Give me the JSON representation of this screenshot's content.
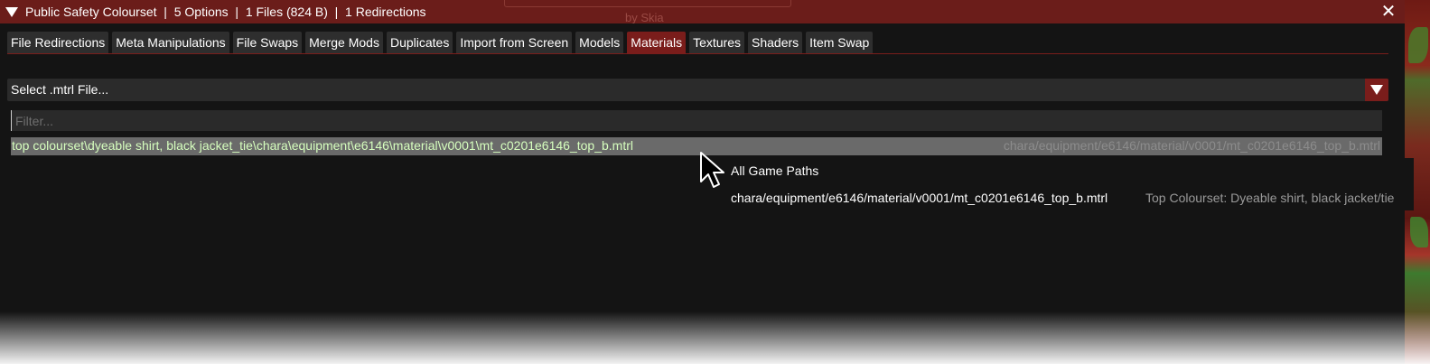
{
  "window": {
    "title": "Public Safety Colourset  |  5 Options  |  1 Files (824 B)  |  1 Redirections",
    "background_title": "by Skia"
  },
  "tabs": [
    {
      "label": "File Redirections"
    },
    {
      "label": "Meta Manipulations"
    },
    {
      "label": "File Swaps"
    },
    {
      "label": "Merge Mods"
    },
    {
      "label": "Duplicates"
    },
    {
      "label": "Import from Screen"
    },
    {
      "label": "Models"
    },
    {
      "label": "Materials",
      "active": true
    },
    {
      "label": "Textures"
    },
    {
      "label": "Shaders"
    },
    {
      "label": "Item Swap"
    }
  ],
  "combo": {
    "label": "Select .mtrl File..."
  },
  "filter": {
    "placeholder": "Filter...",
    "value": ""
  },
  "list": {
    "items": [
      {
        "primary": "top colourset\\dyeable shirt, black jacket_tie\\chara\\equipment\\e6146\\material\\v0001\\mt_c0201e6146_top_b.mtrl",
        "secondary": "chara/equipment/e6146/material/v0001/mt_c0201e6146_top_b.mtrl"
      }
    ]
  },
  "tooltip": {
    "heading": "All Game Paths",
    "path": "chara/equipment/e6146/material/v0001/mt_c0201e6146_top_b.mtrl",
    "mod": "Top Colourset: Dyeable shirt, black jacket/tie"
  },
  "colors": {
    "accent": "#7a1d1b",
    "title_bar": "#6b1d1a",
    "selected_text": "#d6ffbe"
  }
}
